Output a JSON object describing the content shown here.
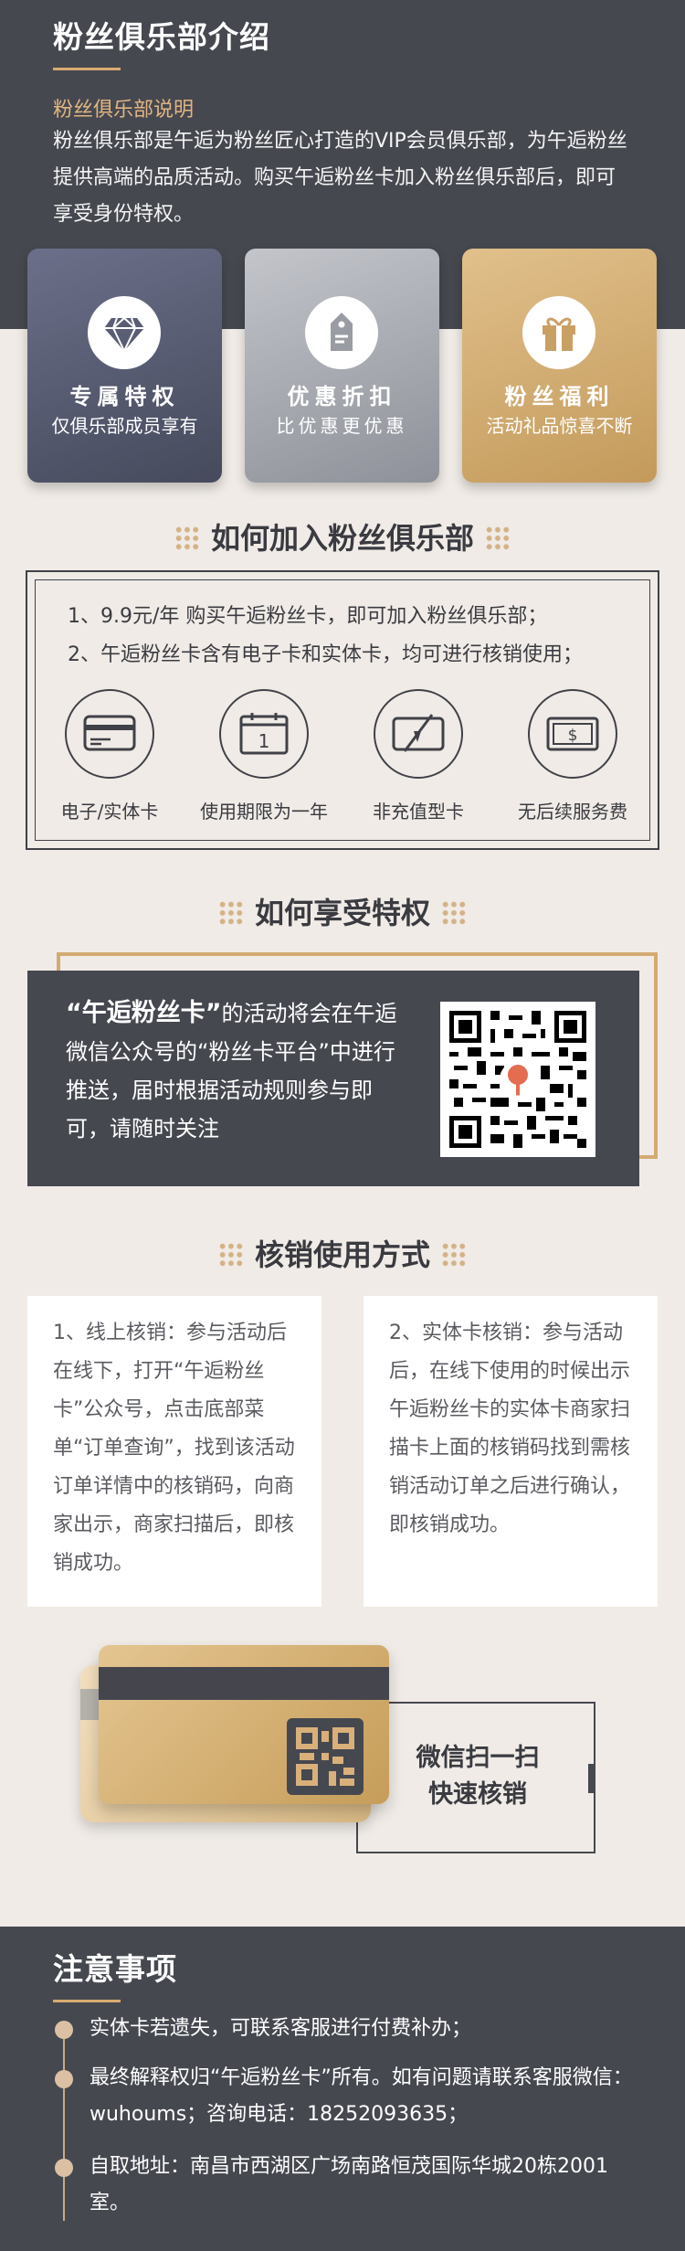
{
  "intro": {
    "title": "粉丝俱乐部介绍",
    "subtitle": "粉丝俱乐部说明",
    "description": "粉丝俱乐部是午逅为粉丝匠心打造的VIP会员俱乐部，为午逅粉丝提供高端的品质活动。购买午逅粉丝卡加入粉丝俱乐部后，即可享受身份特权。"
  },
  "features": [
    {
      "title": "专属特权",
      "subtitle": "仅俱乐部成员享有",
      "icon": "diamond-icon"
    },
    {
      "title": "优惠折扣",
      "subtitle": "比优惠更优惠",
      "icon": "tag-icon"
    },
    {
      "title": "粉丝福利",
      "subtitle": "活动礼品惊喜不断",
      "icon": "gift-icon"
    }
  ],
  "join": {
    "title": "如何加入粉丝俱乐部",
    "lines": [
      "1、9.9元/年 购买午逅粉丝卡，即可加入粉丝俱乐部；",
      "2、午逅粉丝卡含有电子卡和实体卡，均可进行核销使用；"
    ],
    "icons": [
      {
        "label": "电子/实体卡",
        "icon": "credit-card-icon"
      },
      {
        "label": "使用期限为一年",
        "icon": "calendar-icon"
      },
      {
        "label": "非充值型卡",
        "icon": "no-recharge-card-icon"
      },
      {
        "label": "无后续服务费",
        "icon": "banknote-icon"
      }
    ]
  },
  "enjoy": {
    "title": "如何享受特权",
    "emphasis": "“午逅粉丝卡”",
    "text": "的活动将会在午逅微信公众号的“粉丝卡平台”中进行推送，届时根据活动规则参与即可，请随时关注"
  },
  "verify": {
    "title": "核销使用方式",
    "online": "1、线上核销：参与活动后在线下，打开“午逅粉丝卡”公众号，点击底部菜单“订单查询”，找到该活动订单详情中的核销码，向商家出示，商家扫描后，即核销成功。",
    "offline": "2、实体卡核销：参与活动后，在线下使用的时候出示午逅粉丝卡的实体卡商家扫描卡上面的核销码找到需核销活动订单之后进行确认，即核销成功。",
    "scan_line1": "微信扫一扫",
    "scan_line2": "快速核销"
  },
  "notice": {
    "title": "注意事项",
    "items": [
      "实体卡若遗失，可联系客服进行付费补办；",
      "最终解释权归“午逅粉丝卡”所有。如有问题请联系客服微信：wuhoums；咨询电话：18252093635；",
      "自取地址：南昌市西湖区广场南路恒茂国际华城20栋2001室。"
    ]
  },
  "colors": {
    "dark": "#464850",
    "gold": "#d9aa70",
    "background": "#f0ebe6"
  }
}
